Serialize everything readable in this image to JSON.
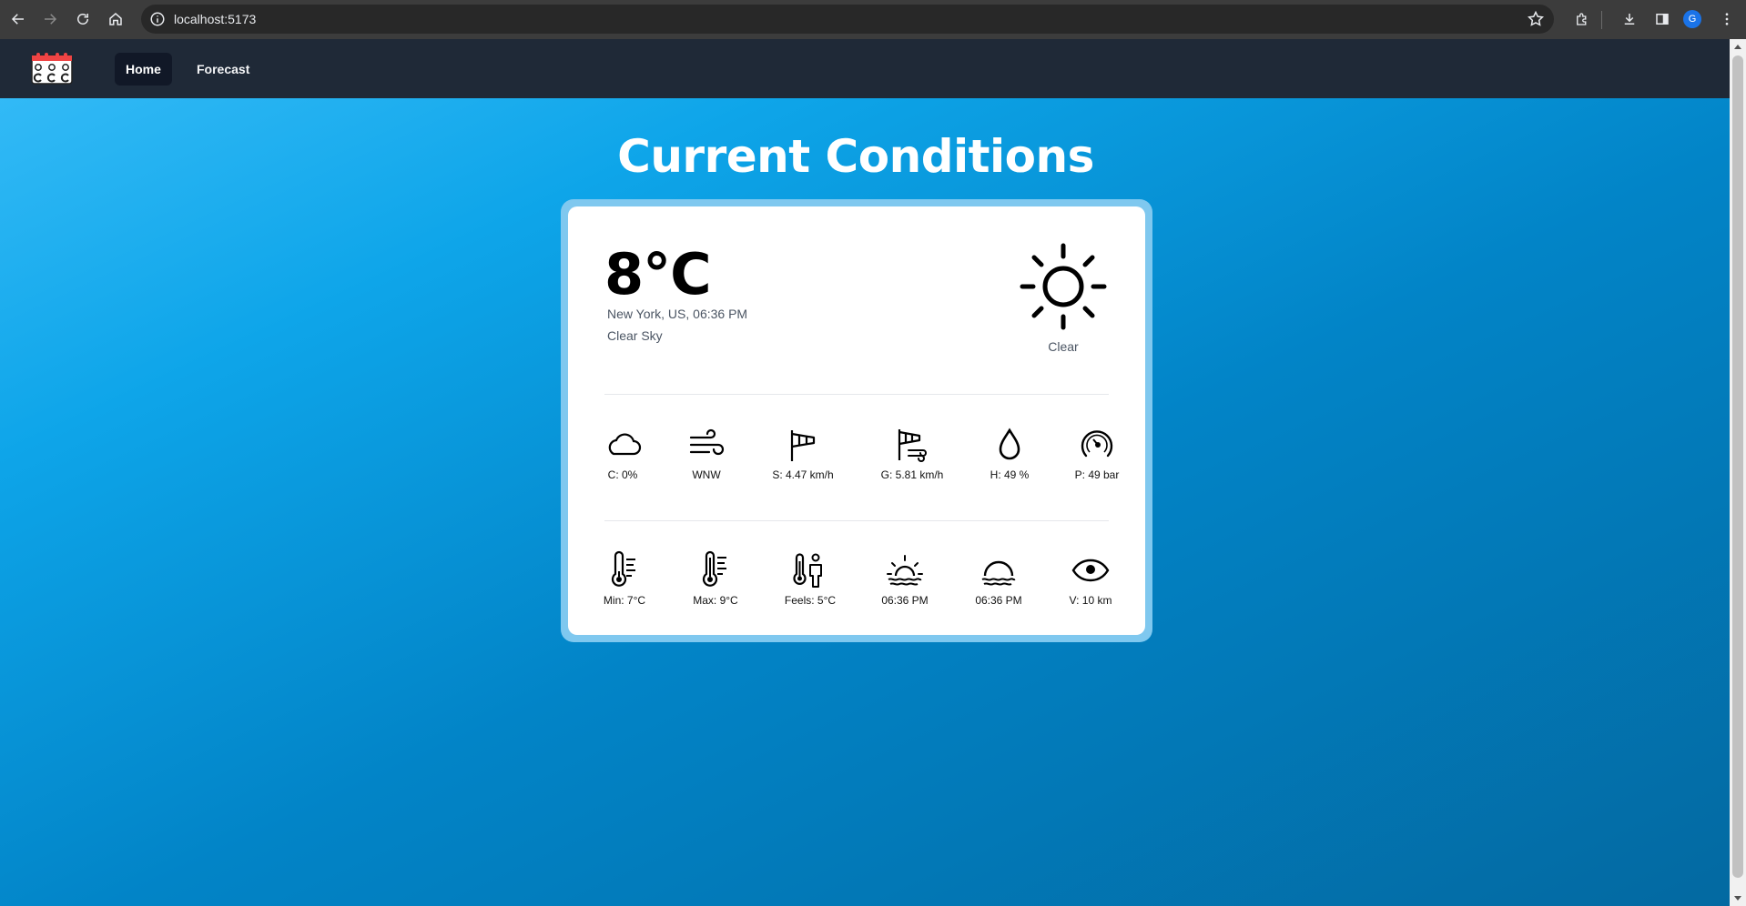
{
  "browser": {
    "url": "localhost:5173",
    "profile_initial": "G"
  },
  "nav": {
    "items": [
      {
        "label": "Home",
        "active": true
      },
      {
        "label": "Forecast",
        "active": false
      }
    ]
  },
  "page": {
    "title": "Current Conditions"
  },
  "current": {
    "temperature": "8°C",
    "location_time": "New York, US, 06:36 PM",
    "description": "Clear Sky",
    "condition_icon": "sun-icon",
    "condition_label": "Clear"
  },
  "details_row1": [
    {
      "icon": "cloud-icon",
      "label": "C: 0%"
    },
    {
      "icon": "wind-icon",
      "label": "WNW"
    },
    {
      "icon": "windsock-icon",
      "label": "S: 4.47 km/h"
    },
    {
      "icon": "wind-gust-icon",
      "label": "G: 5.81 km/h"
    },
    {
      "icon": "raindrop-icon",
      "label": "H: 49 %"
    },
    {
      "icon": "barometer-icon",
      "label": "P: 49 bar"
    }
  ],
  "details_row2": [
    {
      "icon": "thermometer-low-icon",
      "label": "Min: 7°C"
    },
    {
      "icon": "thermometer-high-icon",
      "label": "Max: 9°C"
    },
    {
      "icon": "feels-like-icon",
      "label": "Feels: 5°C"
    },
    {
      "icon": "sunrise-icon",
      "label": "06:36 PM"
    },
    {
      "icon": "sunset-icon",
      "label": "06:36 PM"
    },
    {
      "icon": "eye-icon",
      "label": "V: 10 km"
    }
  ],
  "colors": {
    "nav_bg": "#1f2937",
    "nav_active_bg": "#111827",
    "gradient_start": "#38bdf8",
    "gradient_end": "#0369a1",
    "card_border": "#7fc8ef"
  }
}
